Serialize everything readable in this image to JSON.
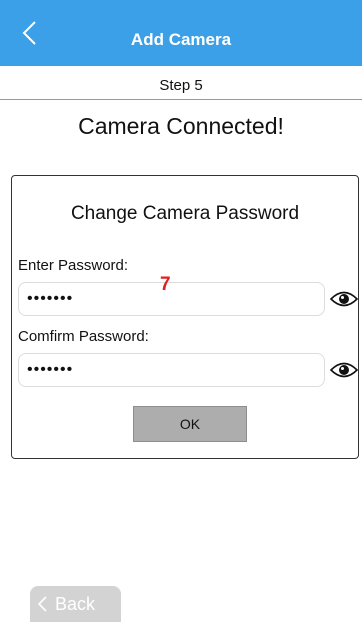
{
  "header": {
    "title": "Add Camera"
  },
  "step": {
    "label": "Step 5"
  },
  "status": {
    "title": "Camera Connected!"
  },
  "form": {
    "title": "Change Camera Password",
    "password_label": "Enter Password:",
    "password_mask": "•••••••",
    "confirm_label": "Comfirm Password:",
    "confirm_mask": "•••••••",
    "ok_label": "OK",
    "marker": "7"
  },
  "footer": {
    "back_label": "Back"
  },
  "colors": {
    "accent": "#3ca0e8",
    "marker": "#e02020",
    "button": "#adadad"
  },
  "icons": {
    "nav_back": "chevron-left-icon",
    "show_password": "eye-icon"
  }
}
